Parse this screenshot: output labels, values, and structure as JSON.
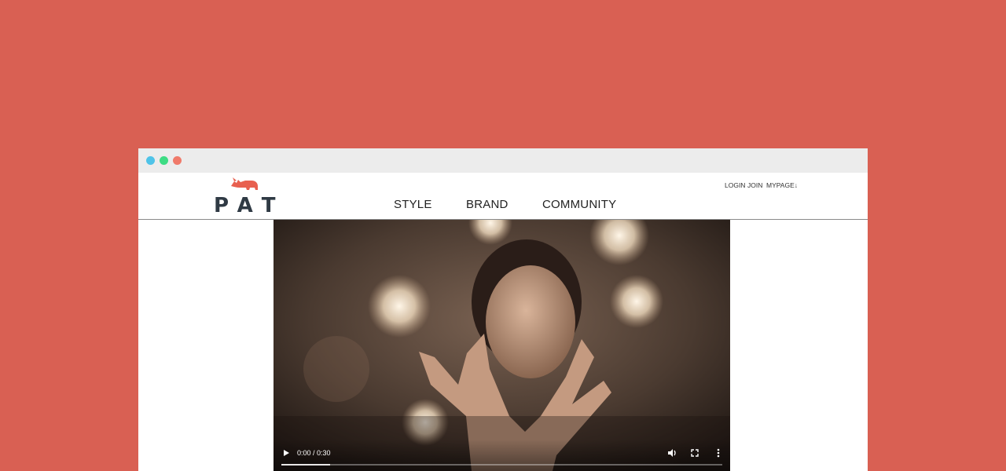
{
  "window": {
    "dots": [
      "#4fc3e8",
      "#3ddc84",
      "#f07a6a"
    ]
  },
  "header": {
    "logo_text": "PAT",
    "logo_icon": "rhino-icon",
    "brand_color": "#e8604f",
    "nav": [
      {
        "label": "STYLE"
      },
      {
        "label": "BRAND"
      },
      {
        "label": "COMMUNITY"
      }
    ],
    "util": [
      {
        "label": "LOGIN"
      },
      {
        "label": "JOIN"
      },
      {
        "label": "MYPAGE↓"
      }
    ]
  },
  "video": {
    "time": "0:00 / 0:30",
    "progress": 0.11,
    "controls": [
      "play-icon",
      "volume-icon",
      "fullscreen-icon",
      "more-vertical-icon"
    ]
  }
}
